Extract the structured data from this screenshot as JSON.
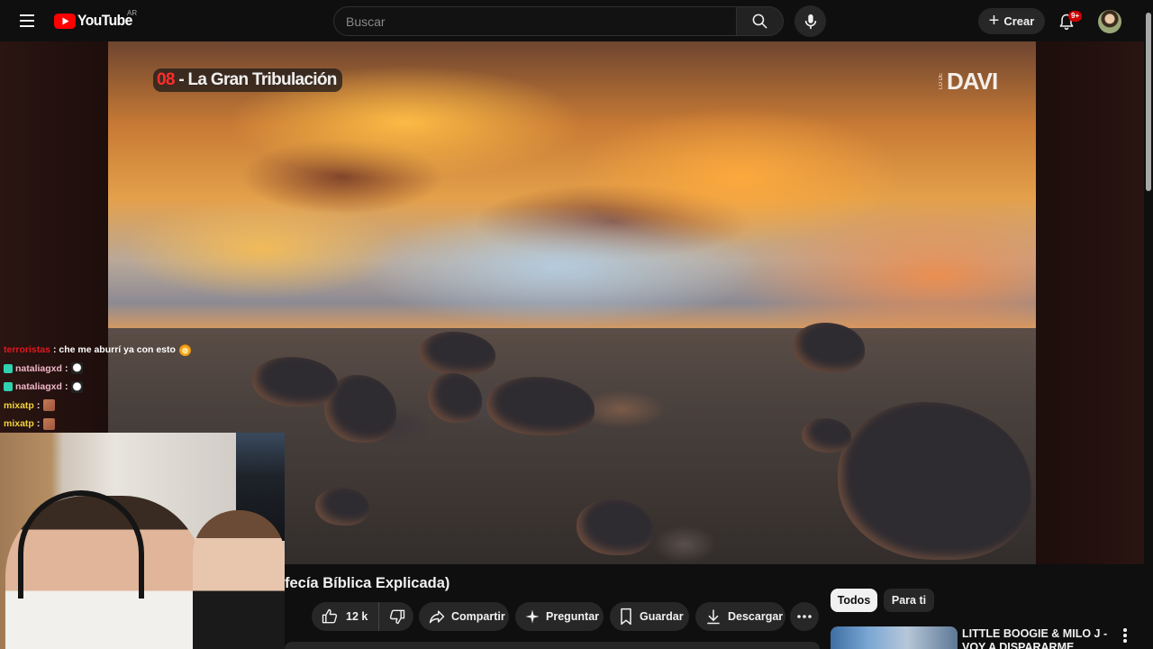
{
  "header": {
    "logo_text": "YouTube",
    "region": "AR",
    "search_placeholder": "Buscar",
    "create_label": "Crear",
    "notifications_badge": "9+"
  },
  "video": {
    "overlay_title_number": "08",
    "overlay_title_text": " - La Gran Tribulación",
    "watermark_small": "LO DE",
    "watermark_big": "DAVI",
    "title": "fecía Bíblica Explicada)"
  },
  "chat": [
    {
      "user": "terroristas",
      "user_color": "#e4161f",
      "message": ": che me aburrí ya con esto",
      "badge": false,
      "emote": "fire"
    },
    {
      "user": "nataliagxd",
      "user_color": "#f1b7c7",
      "message": ":",
      "badge": true,
      "emote": "ghost"
    },
    {
      "user": "nataliagxd",
      "user_color": "#f1b7c7",
      "message": ":",
      "badge": true,
      "emote": "ghost"
    },
    {
      "user": "mixatp",
      "user_color": "#f2d33b",
      "message": ":",
      "badge": false,
      "emote": "dog"
    },
    {
      "user": "mixatp",
      "user_color": "#f2d33b",
      "message": ":",
      "badge": false,
      "emote": "dog"
    }
  ],
  "actions": {
    "likes": "12 k",
    "share": "Compartir",
    "ask": "Preguntar",
    "save": "Guardar",
    "download": "Descargar"
  },
  "chips": {
    "all": "Todos",
    "for_you": "Para ti"
  },
  "recommendation": {
    "title": "LITTLE BOOGIE & MILO J - VOY A DISPARARME (VIDEOCLIP"
  },
  "icons": {
    "menu": "menu-icon",
    "search": "search-icon",
    "mic": "mic-icon",
    "bell": "bell-icon",
    "like": "thumbs-up-icon",
    "dislike": "thumbs-down-icon",
    "share": "share-icon",
    "ask": "sparkle-icon",
    "save": "bookmark-icon",
    "download": "download-icon",
    "more": "more-horizontal-icon"
  },
  "colors": {
    "brand_red": "#ff0000",
    "badge_red": "#cc0000",
    "background": "#0f0f0f",
    "pill": "#272727"
  }
}
